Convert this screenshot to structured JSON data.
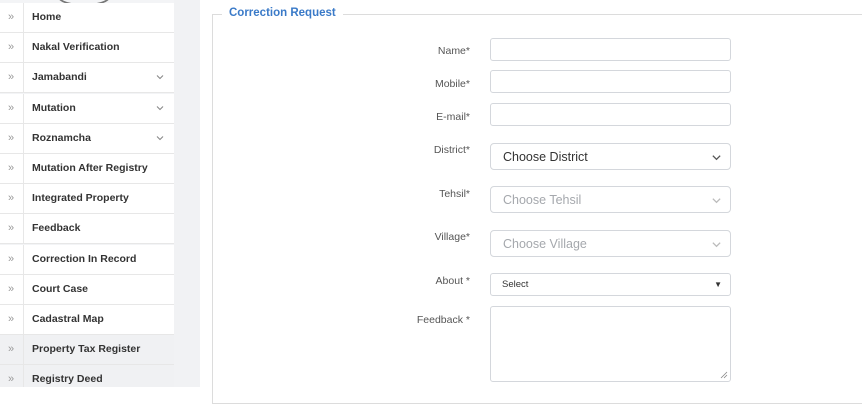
{
  "sidebar": {
    "items": [
      {
        "label": "Home",
        "has_submenu": false
      },
      {
        "label": "Nakal Verification",
        "has_submenu": false
      },
      {
        "label": "Jamabandi",
        "has_submenu": true
      },
      {
        "label": "Mutation",
        "has_submenu": true
      },
      {
        "label": "Roznamcha",
        "has_submenu": true
      },
      {
        "label": "Mutation After Registry",
        "has_submenu": false
      },
      {
        "label": "Integrated Property",
        "has_submenu": false
      },
      {
        "label": "Feedback",
        "has_submenu": false
      },
      {
        "label": "Correction In Record",
        "has_submenu": false
      },
      {
        "label": "Court Case",
        "has_submenu": false
      },
      {
        "label": "Cadastral Map",
        "has_submenu": false
      },
      {
        "label": "Property Tax Register",
        "has_submenu": false
      },
      {
        "label": "Registry Deed",
        "has_submenu": false
      }
    ],
    "item_icon": "double-chevron-right-icon",
    "submenu_icon": "chevron-down-icon"
  },
  "form": {
    "legend": "Correction Request",
    "name_label": "Name*",
    "name_value": "",
    "mobile_label": "Mobile*",
    "mobile_value": "",
    "email_label": "E-mail*",
    "email_value": "",
    "district_label": "District*",
    "district_selected": "Choose District",
    "tehsil_label": "Tehsil*",
    "tehsil_selected": "Choose Tehsil",
    "village_label": "Village*",
    "village_selected": "Choose Village",
    "about_label": "About *",
    "about_selected": "Select",
    "feedback_label": "Feedback *",
    "feedback_value": ""
  },
  "colors": {
    "accent": "#3a7ac8",
    "sidebar_bg": "#f3f4f6",
    "border": "#d4d7dc"
  }
}
